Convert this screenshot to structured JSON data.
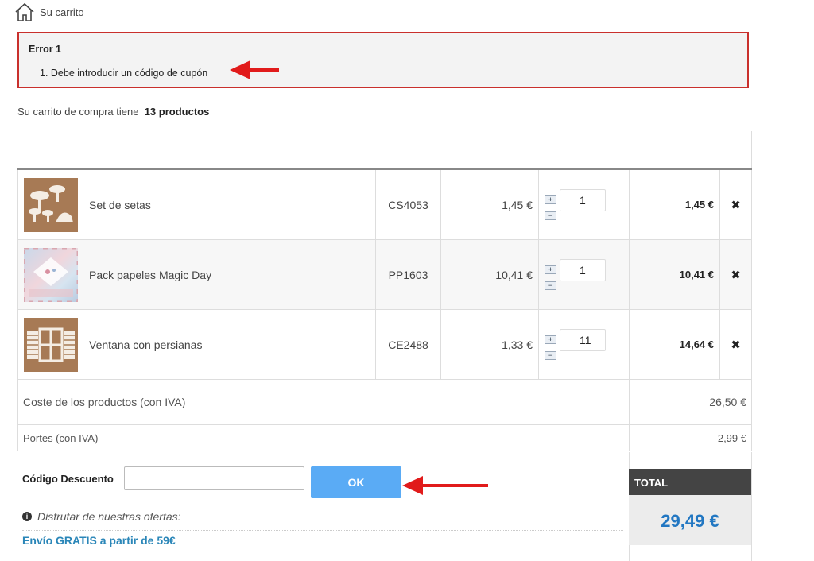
{
  "breadcrumb": {
    "icon": "home-icon",
    "label": "Su carrito"
  },
  "error": {
    "title": "Error 1",
    "items": [
      "1. Debe introducir un código de cupón"
    ],
    "color": "#c9302c"
  },
  "cart_summary": {
    "prefix": "Su carrito de compra tiene",
    "count": "13 productos"
  },
  "items": [
    {
      "name": "Set de setas",
      "ref": "CS4053",
      "unit_price": "1,45 €",
      "qty": "1",
      "total": "1,45 €"
    },
    {
      "name": "Pack papeles Magic Day",
      "ref": "PP1603",
      "unit_price": "10,41 €",
      "qty": "1",
      "total": "10,41 €"
    },
    {
      "name": "Ventana con persianas",
      "ref": "CE2488",
      "unit_price": "1,33 €",
      "qty": "11",
      "total": "14,64 €"
    }
  ],
  "qty_controls": {
    "plus": "+",
    "minus": "−"
  },
  "remove_symbol": "✖",
  "subtotal": {
    "label": "Coste de los productos (con IVA)",
    "value": "26,50 €"
  },
  "shipping": {
    "label": "Portes (con IVA)",
    "value": "2,99 €"
  },
  "discount": {
    "label": "Código Descuento",
    "value": "",
    "button": "OK",
    "button_color": "#5aabf5"
  },
  "offers": {
    "icon": "info-icon",
    "text": "Disfrutar de nuestras ofertas:",
    "promo": "Envío GRATIS a partir de 59€"
  },
  "total": {
    "label": "TOTAL",
    "value": "29,49 €",
    "value_color": "#2277c2"
  }
}
